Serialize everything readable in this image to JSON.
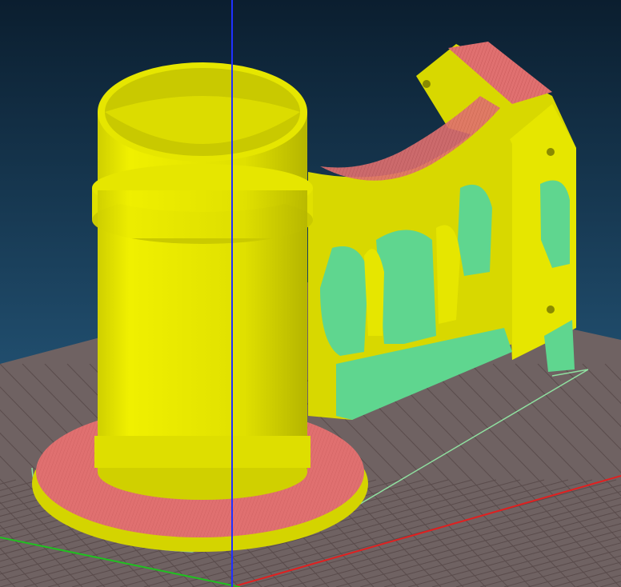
{
  "view": {
    "kind": "3d-slicer-layer-preview",
    "colors": {
      "background_top": "#0b1e2f",
      "background_bottom": "#2d6a93",
      "build_plate": "#6f6262",
      "plate_grid": "#5a4c4c",
      "perimeter_yellow": "#e6e600",
      "perimeter_dark": "#b8b800",
      "infill_red": "#e07070",
      "support_green": "#5fd68f",
      "axis_x": "#e02020",
      "axis_y": "#20c020",
      "axis_z": "#2030ff",
      "skirt": "#8fe0a0"
    }
  }
}
